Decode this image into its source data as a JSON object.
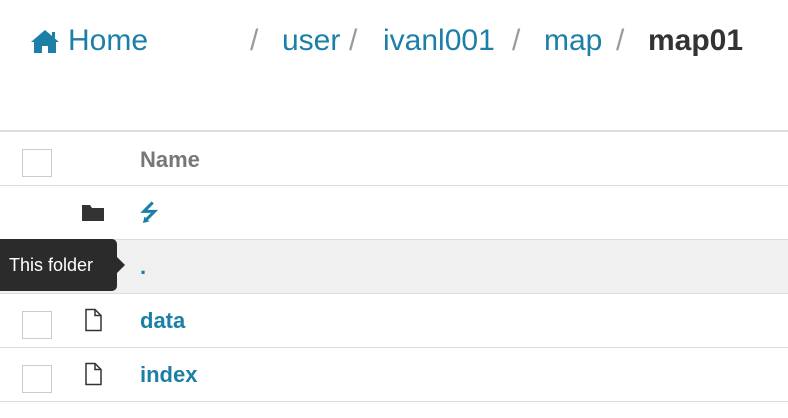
{
  "breadcrumb": {
    "home_label": "Home",
    "separator": "/",
    "items": [
      "user",
      "ivanl001",
      "map"
    ],
    "current": "map01"
  },
  "table": {
    "header": {
      "name": "Name"
    },
    "rows": [
      {
        "icon": "folder-icon",
        "name": "⭍",
        "type": "parent"
      },
      {
        "icon": "folder-icon",
        "name": ".",
        "type": "current-folder"
      },
      {
        "icon": "file-icon",
        "name": "data",
        "type": "file"
      },
      {
        "icon": "file-icon",
        "name": "index",
        "type": "file"
      }
    ]
  },
  "tooltip": {
    "text": "This folder"
  },
  "colors": {
    "link": "#1b7fa6",
    "current": "#333333",
    "tooltip_bg": "#2b2b2b"
  }
}
